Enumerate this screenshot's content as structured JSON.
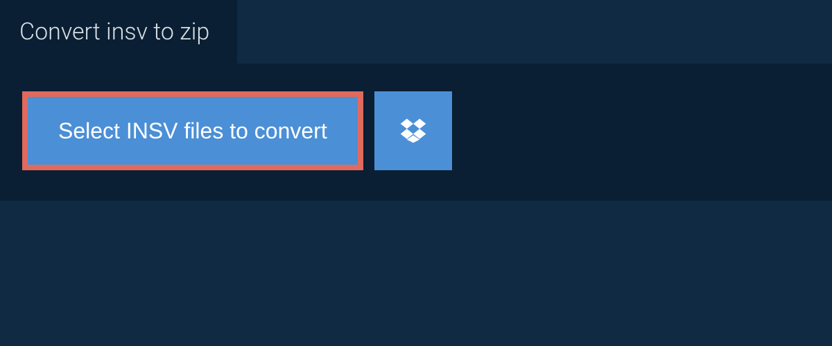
{
  "header": {
    "title": "Convert insv to zip"
  },
  "actions": {
    "select_files_label": "Select INSV files to convert",
    "dropbox_icon_name": "dropbox-icon"
  },
  "colors": {
    "page_bg": "#0f2a42",
    "panel_bg": "#0a1f33",
    "button_bg": "#4b8fd6",
    "highlight_border": "#e16a5e",
    "text_light": "#d9dfe5",
    "text_white": "#ffffff"
  }
}
